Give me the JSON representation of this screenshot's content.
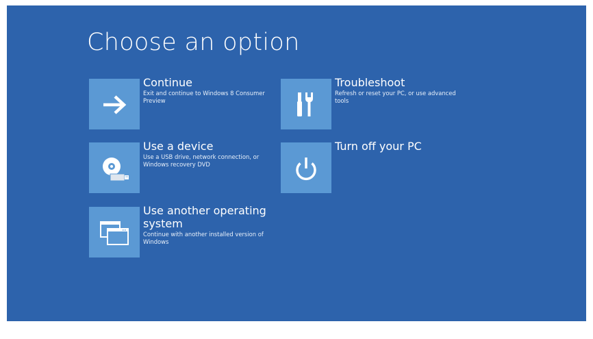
{
  "screen": {
    "title": "Choose an option",
    "background_color": "#2d63ac",
    "tile_color": "#5b99d4"
  },
  "options": [
    {
      "label": "Continue",
      "description": "Exit and continue to Windows 8 Consumer Preview",
      "icon": "arrow-right-icon"
    },
    {
      "label": "Use a device",
      "description": "Use a USB drive, network connection, or Windows recovery DVD",
      "icon": "disc-usb-icon"
    },
    {
      "label": "Use another operating system",
      "description": "Continue with another installed version of Windows",
      "icon": "windows-stack-icon"
    },
    {
      "label": "Troubleshoot",
      "description": "Refresh or reset your PC, or use advanced tools",
      "icon": "tools-icon"
    },
    {
      "label": "Turn off your PC",
      "description": "",
      "icon": "power-icon"
    }
  ]
}
